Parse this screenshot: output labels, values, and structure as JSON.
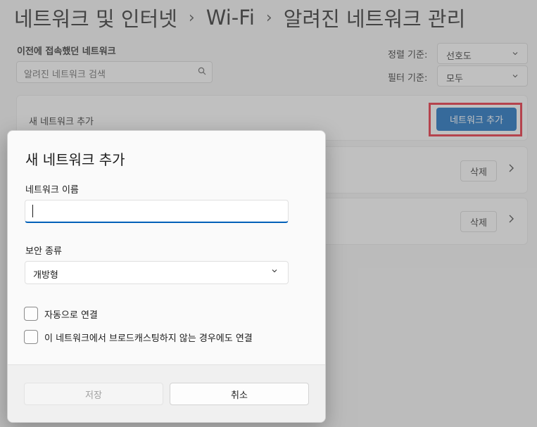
{
  "breadcrumb": [
    "네트워크 및 인터넷",
    "Wi-Fi",
    "알려진 네트워크 관리"
  ],
  "section_title": "이전에 접속했던 네트워크",
  "search": {
    "placeholder": "알려진 네트워크 검색",
    "icon": "search-icon"
  },
  "sort": {
    "label": "정렬 기준:",
    "value": "선호도"
  },
  "filter": {
    "label": "필터 기준:",
    "value": "모두"
  },
  "add_network_card": {
    "label": "새 네트워크 추가",
    "button": "네트워크 추가"
  },
  "network_rows": [
    {
      "delete": "삭제"
    },
    {
      "delete": "삭제"
    }
  ],
  "dialog": {
    "title": "새 네트워크 추가",
    "name_label": "네트워크 이름",
    "name_value": "",
    "security_label": "보안 종류",
    "security_value": "개방형",
    "auto_connect": "자동으로 연결",
    "hidden_connect": "이 네트워크에서 브로드캐스팅하지 않는 경우에도 연결",
    "save": "저장",
    "cancel": "취소"
  },
  "colors": {
    "accent": "#005fb8",
    "highlight": "#e8182a"
  }
}
